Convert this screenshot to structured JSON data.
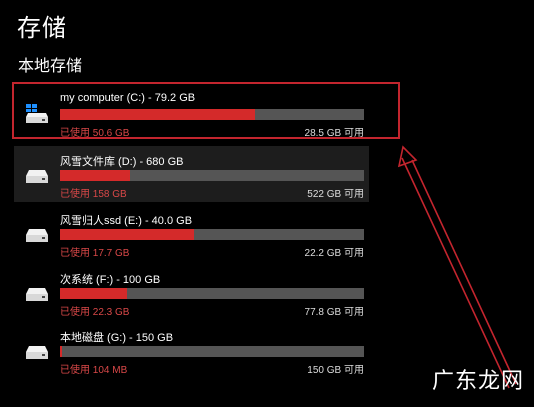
{
  "page": {
    "title": "存储",
    "section_title": "本地存储",
    "watermark": "广东龙网"
  },
  "drives": [
    {
      "name": "my computer (C:) - 79.2 GB",
      "used": "已使用 50.6 GB",
      "free": "28.5 GB 可用",
      "used_fraction": 0.64,
      "icon": "windows-drive-icon"
    },
    {
      "name": "风雪文件库 (D:) - 680 GB",
      "used": "已使用 158 GB",
      "free": "522 GB 可用",
      "used_fraction": 0.23,
      "icon": "drive-icon"
    },
    {
      "name": "风雪归人ssd (E:) - 40.0 GB",
      "used": "已使用 17.7 GB",
      "free": "22.2 GB 可用",
      "used_fraction": 0.44,
      "icon": "drive-icon"
    },
    {
      "name": "次系统 (F:) - 100 GB",
      "used": "已使用 22.3 GB",
      "free": "77.8 GB 可用",
      "used_fraction": 0.22,
      "icon": "drive-icon"
    },
    {
      "name": "本地磁盘 (G:) - 150 GB",
      "used": "已使用 104 MB",
      "free": "150 GB 可用",
      "used_fraction": 0.006,
      "icon": "drive-icon"
    }
  ],
  "colors": {
    "accent_red": "#d42a2a",
    "bar_track": "#555555",
    "highlight": "#c3252e"
  }
}
